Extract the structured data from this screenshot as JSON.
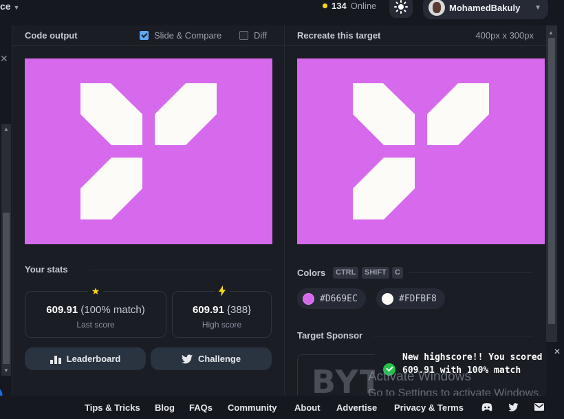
{
  "topbar": {
    "left_text": "ce",
    "online_count": "134",
    "online_label": "Online",
    "username": "MohamedBakuly"
  },
  "output_panel": {
    "title": "Code output",
    "slide_compare_label": "Slide & Compare",
    "slide_compare_checked": true,
    "diff_label": "Diff",
    "diff_checked": false
  },
  "target_panel": {
    "title": "Recreate this target",
    "dimensions": "400px x 300px"
  },
  "stats": {
    "title": "Your stats",
    "last_score_value": "609.91",
    "last_score_match": "(100% match)",
    "last_score_label": "Last score",
    "high_score_value": "609.91",
    "high_score_rank": "{388}",
    "high_score_label": "High score",
    "leaderboard_label": "Leaderboard",
    "challenge_label": "Challenge"
  },
  "colors": {
    "title": "Colors",
    "keys": [
      "CTRL",
      "SHIFT",
      "C"
    ],
    "swatches": [
      {
        "hex": "#D669EC",
        "color": "#d669ec"
      },
      {
        "hex": "#FDFBF8",
        "color": "#fdfbf8"
      }
    ]
  },
  "sponsor": {
    "title": "Target Sponsor",
    "logo_text": "BYT"
  },
  "toast": {
    "message": "New highscore!! You scored 609.91 with 100% match"
  },
  "watermark": {
    "line1": "Activate Windows",
    "line2": "Go to Settings to activate Windows."
  },
  "footer": {
    "links": [
      "Tips & Tricks",
      "Blog",
      "FAQs",
      "Community",
      "About",
      "Advertise",
      "Privacy & Terms"
    ]
  },
  "icons": {
    "theme": "sun-icon",
    "star": "star-icon",
    "bolt": "bolt-icon",
    "leaderboard": "bar-chart-icon",
    "challenge": "twitter-icon",
    "footer": [
      "discord-icon",
      "twitter-icon",
      "mail-icon"
    ]
  }
}
